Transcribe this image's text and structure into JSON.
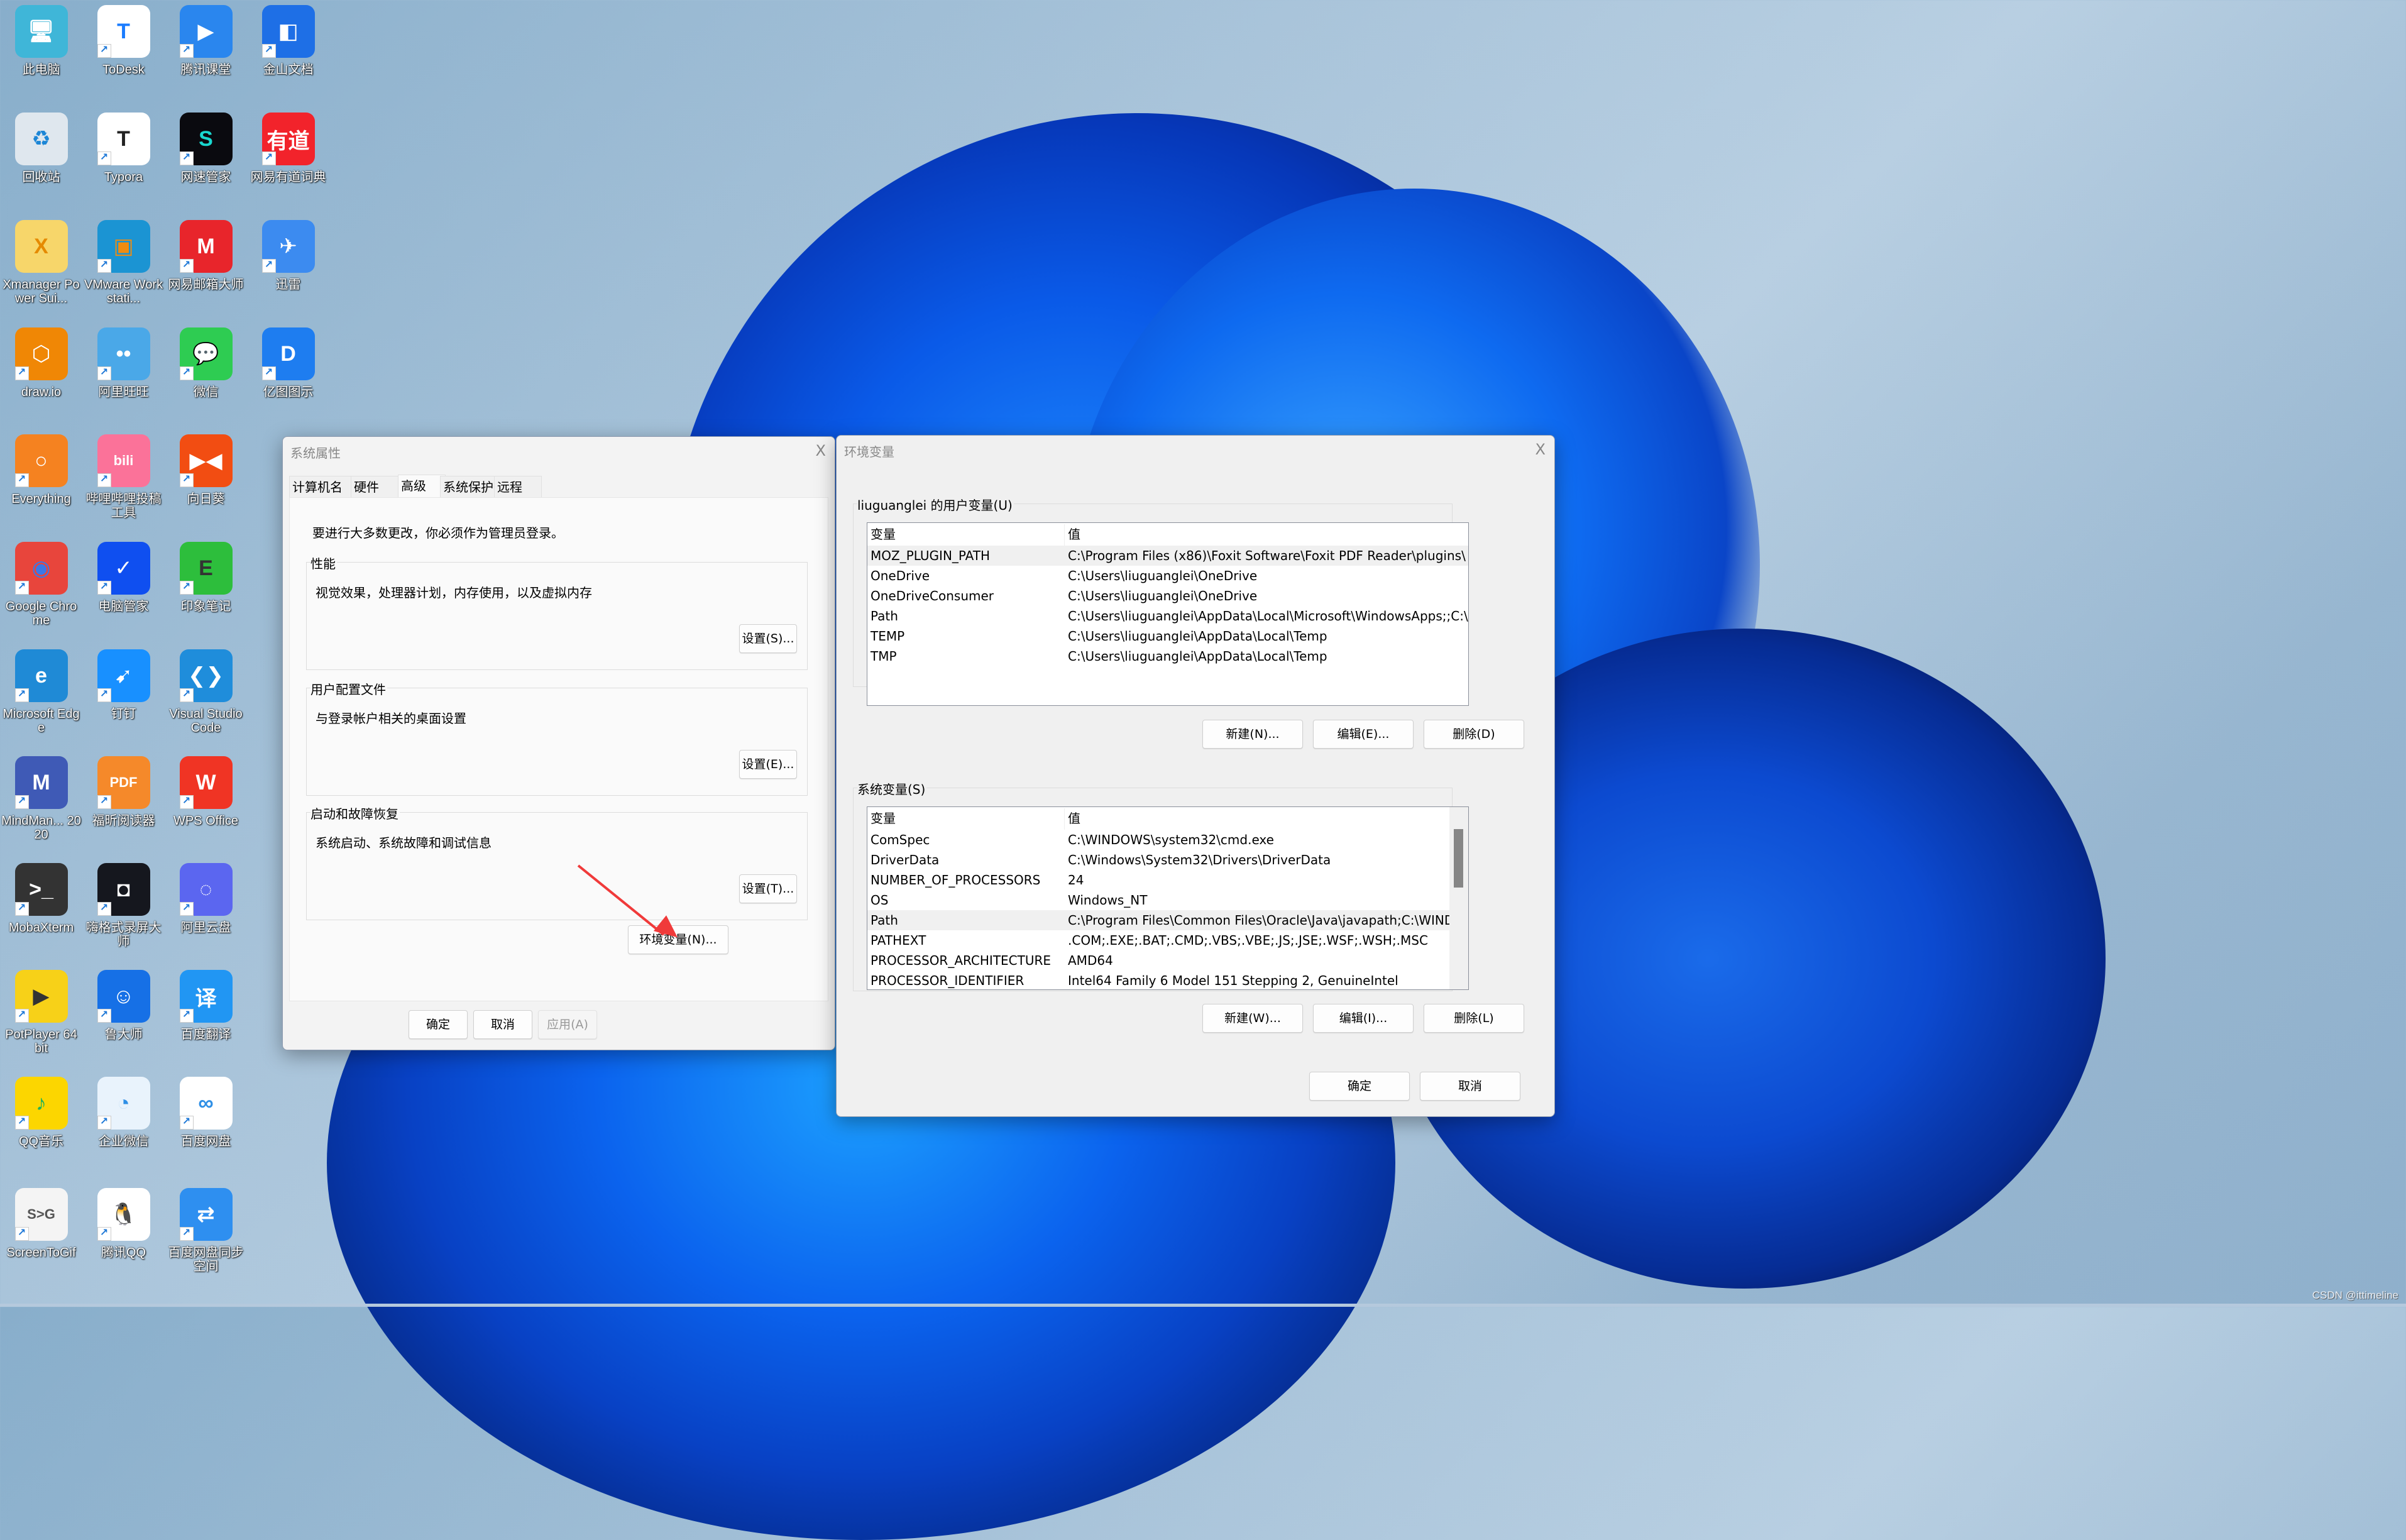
{
  "desktop": {
    "icons": [
      {
        "label": "此电脑",
        "glyph": "🖥",
        "bg": "#3fb6d8",
        "shortcut": false
      },
      {
        "label": "ToDesk",
        "glyph": "T",
        "bg": "#ffffff",
        "fg": "#1a7cff",
        "shortcut": true
      },
      {
        "label": "腾讯课堂",
        "glyph": "▶",
        "bg": "#2a86ee",
        "shortcut": true
      },
      {
        "label": "金山文档",
        "glyph": "◧",
        "bg": "#1e6fe6",
        "shortcut": true
      },
      {
        "label": "回收站",
        "glyph": "♻",
        "bg": "#dfe7ee",
        "fg": "#1c86d6",
        "shortcut": false
      },
      {
        "label": "Typora",
        "glyph": "T",
        "bg": "#ffffff",
        "fg": "#222222",
        "shortcut": true
      },
      {
        "label": "网速管家",
        "glyph": "S",
        "bg": "#0a0a0f",
        "fg": "#19d7cf",
        "shortcut": true
      },
      {
        "label": "网易有道词典",
        "glyph": "有道",
        "bg": "#f2232b",
        "shortcut": true
      },
      {
        "label": "Xmanager Power Sui...",
        "glyph": "X",
        "bg": "#f7d66a",
        "fg": "#e58a00",
        "shortcut": false
      },
      {
        "label": "VMware Workstati...",
        "glyph": "▣",
        "bg": "#1b94d3",
        "fg": "#f08c10",
        "shortcut": true
      },
      {
        "label": "网易邮箱大师",
        "glyph": "M",
        "bg": "#e8252b",
        "shortcut": true
      },
      {
        "label": "迅雷",
        "glyph": "✈",
        "bg": "#3c8bf0",
        "shortcut": true
      },
      {
        "label": "draw.io",
        "glyph": "⬡",
        "bg": "#f08705",
        "shortcut": true
      },
      {
        "label": "阿里旺旺",
        "glyph": "••",
        "bg": "#4aa8e8",
        "shortcut": true
      },
      {
        "label": "微信",
        "glyph": "💬",
        "bg": "#2ecc52",
        "shortcut": true
      },
      {
        "label": "亿图图示",
        "glyph": "D",
        "bg": "#1e7df0",
        "shortcut": true
      },
      {
        "label": "Everything",
        "glyph": "○",
        "bg": "#f58220",
        "shortcut": true
      },
      {
        "label": "哔哩哔哩投稿工具",
        "glyph": "bili",
        "bg": "#fb7299",
        "shortcut": true
      },
      {
        "label": "向日葵",
        "glyph": "▶◀",
        "bg": "#f24d12",
        "shortcut": true
      },
      {
        "label": "Google Chrome",
        "glyph": "◉",
        "bg": "#e8453c",
        "fg": "#3b78e7",
        "shortcut": true
      },
      {
        "label": "电脑管家",
        "glyph": "✓",
        "bg": "#0f4ff0",
        "shortcut": true
      },
      {
        "label": "印象笔记",
        "glyph": "E",
        "bg": "#2dbe3c",
        "fg": "#333333",
        "shortcut": true
      },
      {
        "label": "Microsoft Edge",
        "glyph": "e",
        "bg": "#1f8ad6",
        "shortcut": true
      },
      {
        "label": "钉钉",
        "glyph": "➹",
        "bg": "#1890ff",
        "shortcut": true
      },
      {
        "label": "Visual Studio Code",
        "glyph": "❮❯",
        "bg": "#1f8ddb",
        "shortcut": true
      },
      {
        "label": "MindMan... 2020",
        "glyph": "M",
        "bg": "#3f5ab6",
        "shortcut": true
      },
      {
        "label": "福昕阅读器",
        "glyph": "PDF",
        "bg": "#f5892a",
        "shortcut": true
      },
      {
        "label": "WPS Office",
        "glyph": "W",
        "bg": "#f03424",
        "shortcut": true
      },
      {
        "label": "MobaXterm",
        "glyph": ">_",
        "bg": "#333333",
        "shortcut": true
      },
      {
        "label": "嗨格式录屏大师",
        "glyph": "◘",
        "bg": "#15171e",
        "shortcut": true
      },
      {
        "label": "阿里云盘",
        "glyph": "◌",
        "bg": "#5b66f0",
        "shortcut": true
      },
      {
        "label": "PotPlayer 64 bit",
        "glyph": "▶",
        "bg": "#f7d118",
        "fg": "#333333",
        "shortcut": true
      },
      {
        "label": "鲁大师",
        "glyph": "☺",
        "bg": "#1670e6",
        "shortcut": true
      },
      {
        "label": "百度翻译",
        "glyph": "译",
        "bg": "#2196f3",
        "shortcut": true
      },
      {
        "label": "QQ音乐",
        "glyph": "♪",
        "bg": "#fcd600",
        "fg": "#21b25a",
        "shortcut": true
      },
      {
        "label": "企业微信",
        "glyph": "◔",
        "bg": "#e9f3fc",
        "fg": "#2e8fe6",
        "shortcut": true
      },
      {
        "label": "百度网盘",
        "glyph": "∞",
        "bg": "#ffffff",
        "fg": "#2e8fe6",
        "shortcut": true
      },
      {
        "label": "ScreenToGif",
        "glyph": "S>G",
        "bg": "#f4f4f4",
        "fg": "#555555",
        "shortcut": true
      },
      {
        "label": "腾讯QQ",
        "glyph": "🐧",
        "bg": "#ffffff",
        "fg": "#000000",
        "shortcut": true
      },
      {
        "label": "百度网盘同步空间",
        "glyph": "⇄",
        "bg": "#2e8ff0",
        "shortcut": true
      }
    ]
  },
  "system_properties": {
    "title": "系统属性",
    "close_label": "X",
    "tabs": [
      {
        "label": "计算机名",
        "active": false
      },
      {
        "label": "硬件",
        "active": false
      },
      {
        "label": "高级",
        "active": true
      },
      {
        "label": "系统保护",
        "active": false
      },
      {
        "label": "远程",
        "active": false
      }
    ],
    "admin_note": "要进行大多数更改，你必须作为管理员登录。",
    "groups": {
      "performance": {
        "title": "性能",
        "desc": "视觉效果，处理器计划，内存使用，以及虚拟内存",
        "button": "设置(S)..."
      },
      "user_profiles": {
        "title": "用户配置文件",
        "desc": "与登录帐户相关的桌面设置",
        "button": "设置(E)..."
      },
      "startup_recovery": {
        "title": "启动和故障恢复",
        "desc": "系统启动、系统故障和调试信息",
        "button": "设置(T)..."
      }
    },
    "env_button": "环境变量(N)...",
    "ok": "确定",
    "cancel": "取消",
    "apply": "应用(A)"
  },
  "environment_variables": {
    "title": "环境变量",
    "close_label": "X",
    "user_section_title": "liuguanglei 的用户变量(U)",
    "columns": {
      "name": "变量",
      "value": "值"
    },
    "user_vars": [
      {
        "name": "MOZ_PLUGIN_PATH",
        "value": "C:\\Program Files (x86)\\Foxit Software\\Foxit PDF Reader\\plugins\\",
        "selected": true
      },
      {
        "name": "OneDrive",
        "value": "C:\\Users\\liuguanglei\\OneDrive",
        "selected": false
      },
      {
        "name": "OneDriveConsumer",
        "value": "C:\\Users\\liuguanglei\\OneDrive",
        "selected": false
      },
      {
        "name": "Path",
        "value": "C:\\Users\\liuguanglei\\AppData\\Local\\Microsoft\\WindowsApps;;C:\\...",
        "selected": false
      },
      {
        "name": "TEMP",
        "value": "C:\\Users\\liuguanglei\\AppData\\Local\\Temp",
        "selected": false
      },
      {
        "name": "TMP",
        "value": "C:\\Users\\liuguanglei\\AppData\\Local\\Temp",
        "selected": false
      }
    ],
    "user_buttons": {
      "new": "新建(N)...",
      "edit": "编辑(E)...",
      "delete": "删除(D)"
    },
    "system_section_title": "系统变量(S)",
    "system_vars": [
      {
        "name": "ComSpec",
        "value": "C:\\WINDOWS\\system32\\cmd.exe",
        "selected": false
      },
      {
        "name": "DriverData",
        "value": "C:\\Windows\\System32\\Drivers\\DriverData",
        "selected": false
      },
      {
        "name": "NUMBER_OF_PROCESSORS",
        "value": "24",
        "selected": false
      },
      {
        "name": "OS",
        "value": "Windows_NT",
        "selected": false
      },
      {
        "name": "Path",
        "value": "C:\\Program Files\\Common Files\\Oracle\\Java\\javapath;C:\\WINDOW...",
        "selected": true
      },
      {
        "name": "PATHEXT",
        "value": ".COM;.EXE;.BAT;.CMD;.VBS;.VBE;.JS;.JSE;.WSF;.WSH;.MSC",
        "selected": false
      },
      {
        "name": "PROCESSOR_ARCHITECTURE",
        "value": "AMD64",
        "selected": false
      },
      {
        "name": "PROCESSOR_IDENTIFIER",
        "value": "Intel64 Family 6 Model 151 Stepping 2, GenuineIntel",
        "selected": false
      }
    ],
    "system_scroll": {
      "position_fraction": 0.1,
      "visible_fraction": 0.34
    },
    "system_buttons": {
      "new": "新建(W)...",
      "edit": "编辑(I)...",
      "delete": "删除(L)"
    },
    "ok": "确定",
    "cancel": "取消"
  },
  "watermark": "CSDN @ittimeline"
}
